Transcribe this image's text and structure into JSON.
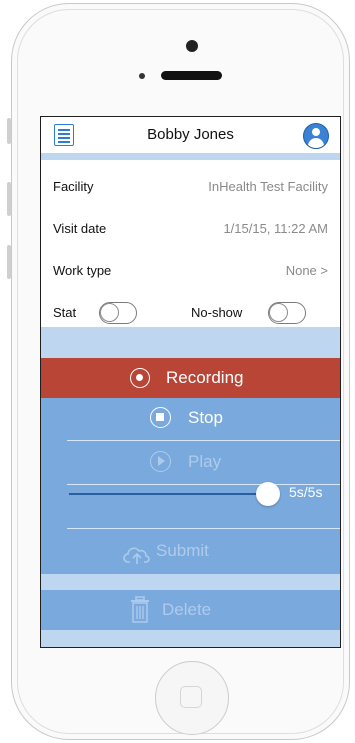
{
  "header": {
    "title": "Bobby Jones"
  },
  "form": {
    "facility_label": "Facility",
    "facility_value": "InHealth Test Facility",
    "visit_date_label": "Visit date",
    "visit_date_value": "1/15/15,  11:22 AM",
    "work_type_label": "Work type",
    "work_type_value": "None >",
    "stat_label": "Stat",
    "stat_on": false,
    "noshow_label": "No-show",
    "noshow_on": false
  },
  "actions": {
    "recording_label": "Recording",
    "stop_label": "Stop",
    "play_label": "Play",
    "progress_readout": "5s/5s",
    "progress_fraction": 1.0,
    "submit_label": "Submit",
    "delete_label": "Delete"
  },
  "colors": {
    "recording_bar": "#b84535",
    "control_blue": "#7aa9dd",
    "screen_bg": "#bed6ef",
    "disabled_text": "#aecbec"
  },
  "icons": {
    "menu": "menu-list-icon",
    "avatar": "user-avatar-icon",
    "recording": "record-dot-icon",
    "stop": "stop-icon",
    "play": "play-icon",
    "submit": "cloud-upload-icon",
    "delete": "trash-icon"
  }
}
